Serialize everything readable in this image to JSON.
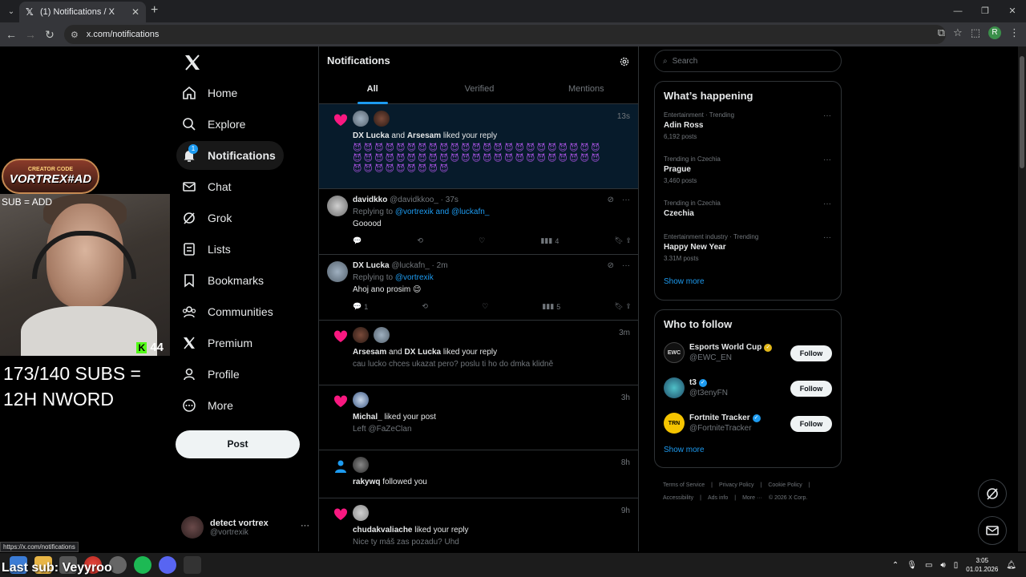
{
  "browser": {
    "tab_title": "(1) Notifications / X",
    "url": "x.com/notifications",
    "status_url": "https://x.com/notifications"
  },
  "overlay": {
    "logo_small": "CREATOR CODE",
    "logo_big": "VORTREX#AD",
    "sub_add": "SUB = ADD",
    "kick_count": "44",
    "goal_line1": "173/140 SUBS =",
    "goal_line2": "12H NWORD",
    "last_sub": "Last sub: Veyyroo"
  },
  "nav": {
    "items": [
      {
        "label": "Home",
        "icon": "home-icon"
      },
      {
        "label": "Explore",
        "icon": "search-icon"
      },
      {
        "label": "Notifications",
        "icon": "bell-icon",
        "badge": "1"
      },
      {
        "label": "Chat",
        "icon": "mail-icon"
      },
      {
        "label": "Grok",
        "icon": "grok-icon"
      },
      {
        "label": "Lists",
        "icon": "list-icon"
      },
      {
        "label": "Bookmarks",
        "icon": "bookmark-icon"
      },
      {
        "label": "Communities",
        "icon": "communities-icon"
      },
      {
        "label": "Premium",
        "icon": "x-icon"
      },
      {
        "label": "Profile",
        "icon": "profile-icon"
      },
      {
        "label": "More",
        "icon": "more-circle-icon"
      }
    ],
    "post_label": "Post",
    "account_name": "detect vortrex",
    "account_handle": "@vortrexik"
  },
  "main": {
    "title": "Notifications",
    "tabs": [
      "All",
      "Verified",
      "Mentions"
    ],
    "n1": {
      "time": "13s",
      "user1": "DX Lucka",
      "and": "and",
      "user2": "Arsesam",
      "action": "liked your reply"
    },
    "r1": {
      "name": "davidkko",
      "handle": "@davidkkoo_ · 37s",
      "replying": "Replying to",
      "to": "@vortrexik and @luckafn_",
      "body": "Gooood",
      "views": "4"
    },
    "r2": {
      "name": "DX Lucka",
      "handle": "@luckafn_ · 2m",
      "replying": "Replying to",
      "to": "@vortrexik",
      "body": "Ahoj ano prosim 😉",
      "replies": "1",
      "views": "5"
    },
    "n2": {
      "time": "3m",
      "user1": "Arsesam",
      "and": "and",
      "user2": "DX Lucka",
      "action": "liked your reply",
      "sub": "cau lucko chces ukazat pero? poslu ti ho do dmka klidně"
    },
    "n3": {
      "time": "3h",
      "user1": "Michal_",
      "action": "liked your post",
      "sub": "Left @FaZeClan"
    },
    "n4": {
      "time": "8h",
      "user1": "rakywq",
      "action": "followed you"
    },
    "n5": {
      "time": "9h",
      "user1": "chudakvaliache",
      "action": "liked your reply",
      "sub": "Nice ty máš zas pozadu? Uhd"
    }
  },
  "right": {
    "search_placeholder": "Search",
    "happening_title": "What’s happening",
    "trends": [
      {
        "context": "Entertainment · Trending",
        "title": "Adin Ross",
        "posts": "6,192 posts"
      },
      {
        "context": "Trending in Czechia",
        "title": "Prague",
        "posts": "3,460 posts"
      },
      {
        "context": "Trending in Czechia",
        "title": "Czechia",
        "posts": ""
      },
      {
        "context": "Entertainment industry · Trending",
        "title": "Happy New Year",
        "posts": "3.31M posts"
      }
    ],
    "show_more": "Show more",
    "who_title": "Who to follow",
    "who": [
      {
        "name": "Esports World Cup",
        "handle": "@EWC_EN",
        "badge_color": "#e2b719",
        "avatar_text": "EWC"
      },
      {
        "name": "t3",
        "handle": "@t3enyFN",
        "badge_color": "#1d9bf0",
        "avatar_text": ""
      },
      {
        "name": "Fortnite Tracker",
        "handle": "@FortniteTracker",
        "badge_color": "#1d9bf0",
        "avatar_text": "TRN"
      }
    ],
    "follow_label": "Follow",
    "footer": [
      "Terms of Service",
      "|",
      "Privacy Policy",
      "|",
      "Cookie Policy",
      "|",
      "Accessibility",
      "|",
      "Ads info",
      "|",
      "More ···",
      "© 2026 X Corp."
    ]
  },
  "taskbar": {
    "time": "3:05",
    "date": "01.01.2026"
  },
  "colors": {
    "accent": "#1d9bf0",
    "like": "#f91880",
    "unread_bg": "#071b2b"
  }
}
